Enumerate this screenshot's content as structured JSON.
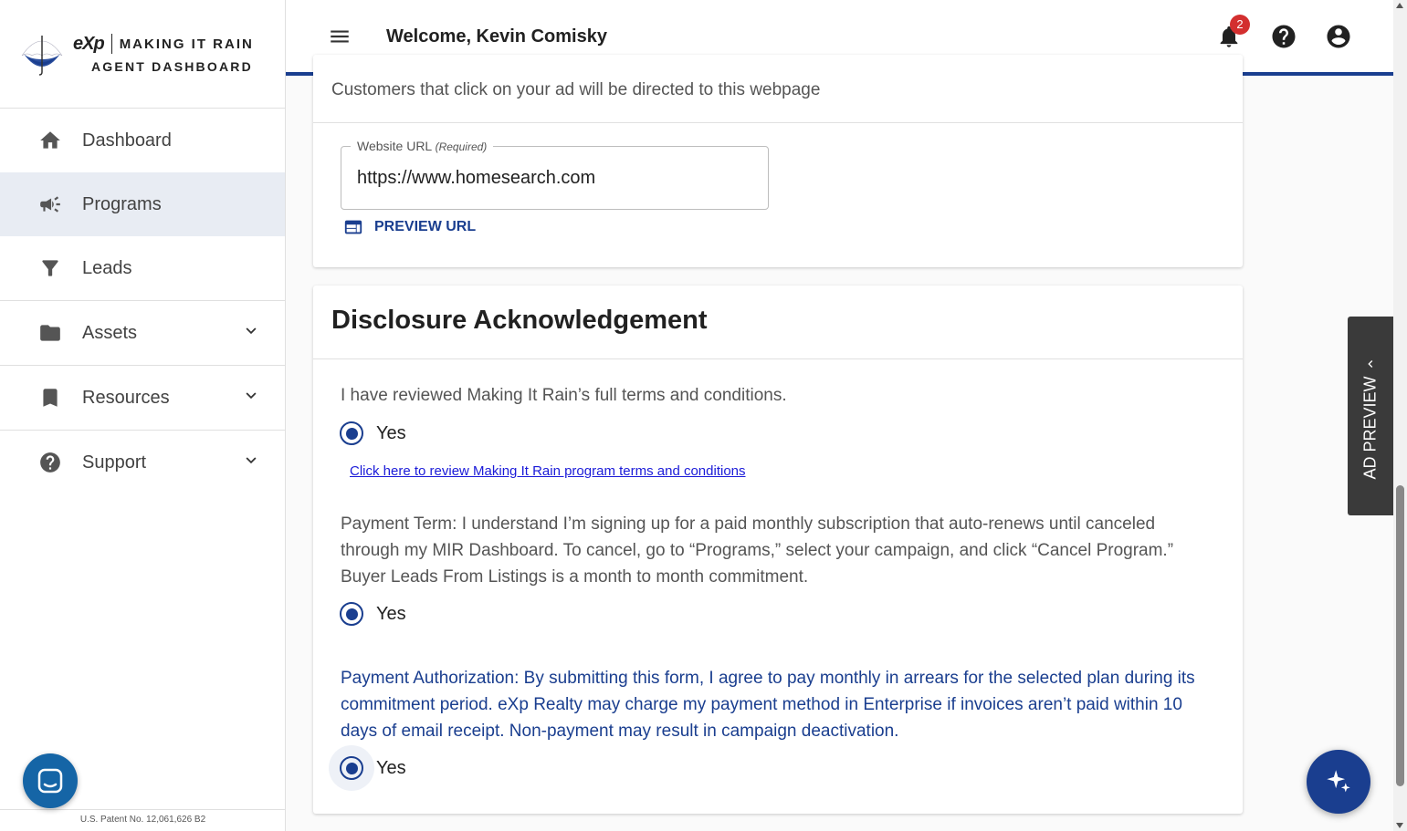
{
  "sidebar": {
    "logo": {
      "brand": "eXp",
      "title": "MAKING IT RAIN",
      "subtitle": "AGENT DASHBOARD"
    },
    "items": [
      {
        "label": "Dashboard",
        "icon": "home-icon"
      },
      {
        "label": "Programs",
        "icon": "megaphone-icon",
        "active": true
      },
      {
        "label": "Leads",
        "icon": "funnel-icon"
      },
      {
        "label": "Assets",
        "icon": "folder-icon",
        "expandable": true
      },
      {
        "label": "Resources",
        "icon": "bookmark-icon",
        "expandable": true
      },
      {
        "label": "Support",
        "icon": "help-circle-icon",
        "expandable": true
      }
    ],
    "patent": "U.S. Patent No. 12,061,626 B2"
  },
  "header": {
    "welcome": "Welcome, Kevin Comisky",
    "notification_count": "2"
  },
  "website_card": {
    "subtitle": "Customers that click on your ad will be directed to this webpage",
    "url_label": "Website URL",
    "url_required": "(Required)",
    "url_value": "https://www.homesearch.com",
    "preview_label": "PREVIEW URL"
  },
  "disclosure": {
    "title": "Disclosure Acknowledgement",
    "terms_text": "I have reviewed Making It Rain’s full terms and conditions.",
    "terms_answer": "Yes",
    "terms_link": "Click here to review Making It Rain program terms and conditions",
    "payment_term_text": "Payment Term: I understand I’m signing up for a paid monthly subscription that auto-renews until canceled through my MIR Dashboard. To cancel, go to “Programs,” select your campaign, and click “Cancel Program.” Buyer Leads From Listings is a month to month commitment.",
    "payment_term_answer": "Yes",
    "payment_auth_text": "Payment Authorization: By submitting this form, I agree to pay monthly in arrears for the selected plan during its commitment period. eXp Realty may charge my payment method in Enterprise if invoices aren’t paid within 10 days of email receipt. Non-payment may result in campaign deactivation.",
    "payment_auth_answer": "Yes"
  },
  "ad_preview": {
    "label": "AD PREVIEW"
  },
  "colors": {
    "primary": "#1a3e8f",
    "active_nav": "#e8ecf3",
    "badge": "#d32f2f"
  }
}
